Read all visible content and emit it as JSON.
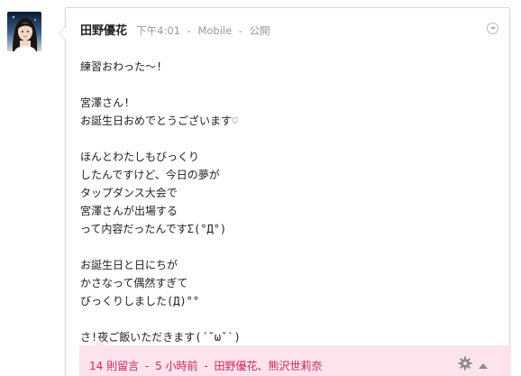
{
  "post": {
    "author": "田野優花",
    "time": "下午4:01",
    "source": "Mobile",
    "visibility": "公開",
    "separator": "-",
    "lines": [
      "練習おわった〜!",
      "",
      "宮澤さん!",
      "お誕生日おめでとうございます♡",
      "",
      "ほんとわたしもびっくり",
      "したんですけど、今日の夢が",
      "タップダンス大会で",
      "宮澤さんが出場する",
      "って内容だったんですΣ(°Д°)",
      "",
      "お誕生日と日にちが",
      "かさなって偶然すぎて",
      "びっくりしました(Д)°°",
      "",
      "さ!夜ご飯いただきます(´˘ω˘`)"
    ]
  },
  "comments": {
    "count_label": "14 則留言",
    "time_ago": "5 小時前",
    "commenters": "田野優花、熊沢世莉奈",
    "separator": "-"
  },
  "colors": {
    "accent": "#d4275f",
    "comments_bg": "#fde3ec",
    "meta": "#999999"
  },
  "icons": {
    "avatar": "avatar",
    "menu": "chevron-down-icon",
    "settings": "gear-icon",
    "collapse": "collapse-up-icon"
  }
}
